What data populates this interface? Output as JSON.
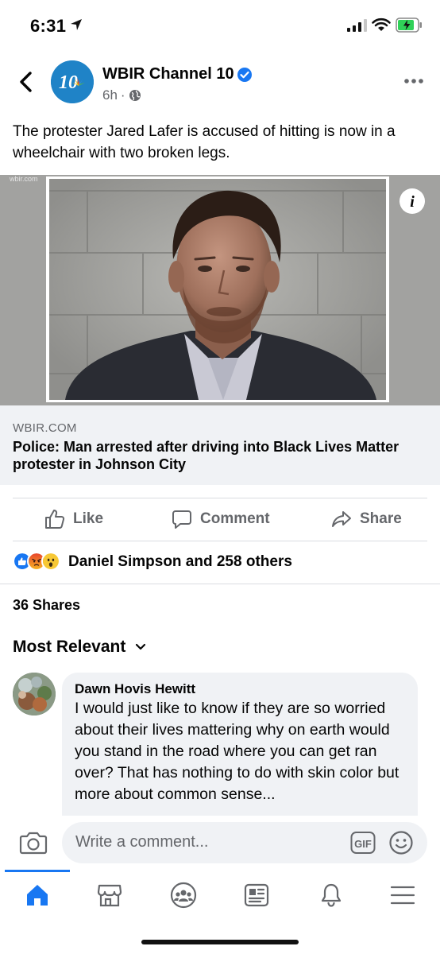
{
  "status_bar": {
    "time": "6:31",
    "icons": [
      "location-arrow-icon",
      "signal-icon",
      "wifi-icon",
      "battery-charging-icon"
    ]
  },
  "post": {
    "page_name": "WBIR Channel 10",
    "avatar_text": "10",
    "time_ago": "6h",
    "text": "The protester Jared Lafer is accused of hitting is now in a wheelchair with two broken legs.",
    "image_watermark": "wbir.com"
  },
  "link_preview": {
    "domain": "WBIR.COM",
    "title": "Police: Man arrested after driving into Black Lives Matter protester in Johnson City"
  },
  "actions": {
    "like": "Like",
    "comment": "Comment",
    "share": "Share"
  },
  "reactions": {
    "summary": "Daniel Simpson and 258 others",
    "types": [
      "like",
      "angry",
      "wow"
    ]
  },
  "shares": "36 Shares",
  "comments_sort": "Most Relevant",
  "comment": {
    "author": "Dawn Hovis Hewitt",
    "text": "I would just like to know if they are so worried about their lives mattering why on earth would you stand in the road where you can get ran over? That has nothing to do with skin color but more about common sense..."
  },
  "composer": {
    "placeholder": "Write a comment...",
    "gif_label": "GIF"
  },
  "tab_bar": {
    "tabs": [
      "home",
      "marketplace",
      "groups",
      "news",
      "notifications",
      "menu"
    ],
    "active": "home"
  },
  "colors": {
    "accent": "#1877f2",
    "secondary_text": "#65676b",
    "bubble": "#f0f2f5"
  }
}
